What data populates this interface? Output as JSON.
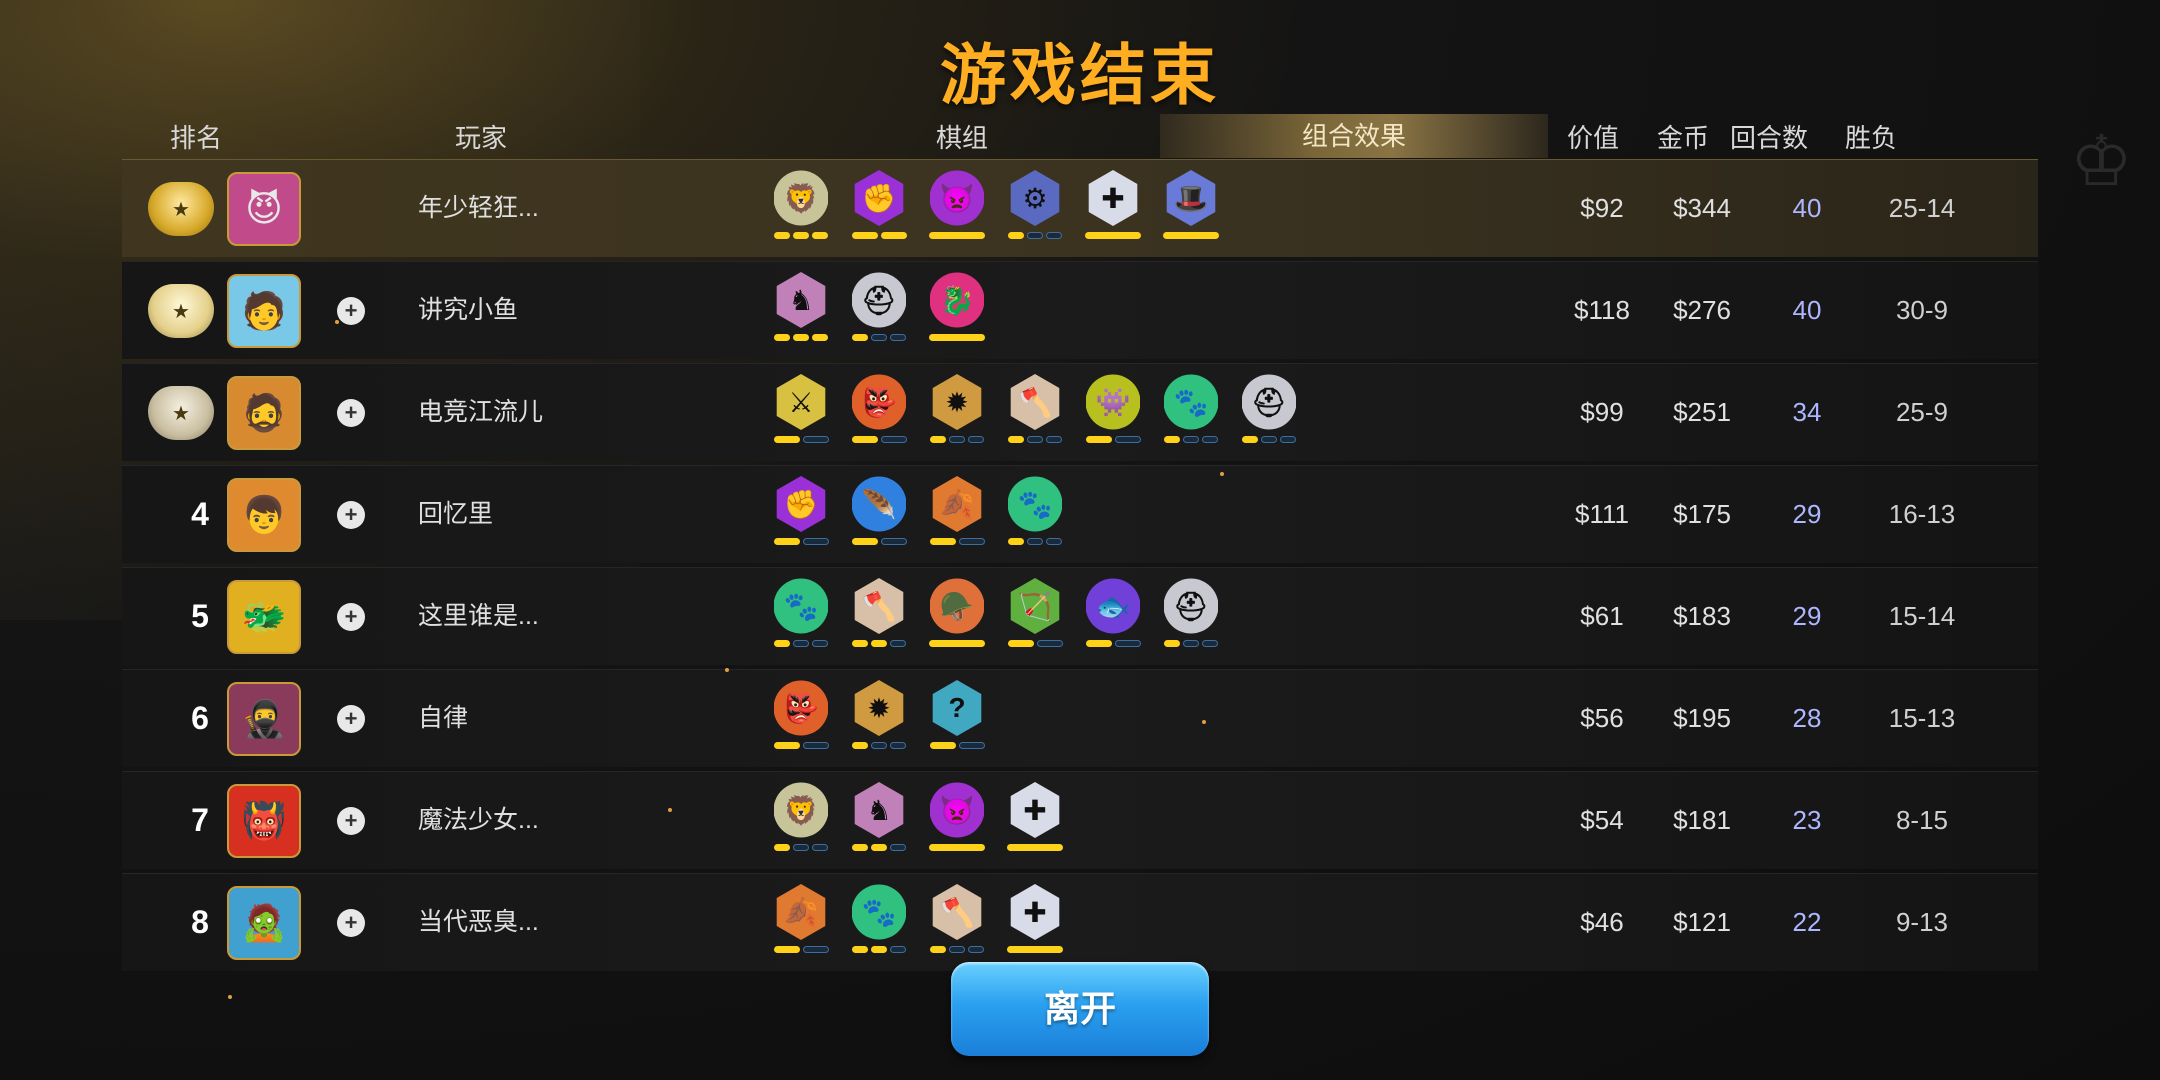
{
  "title": "游戏结束",
  "headers": {
    "rank": "排名",
    "player": "玩家",
    "pieces": "棋组",
    "combo": "组合效果",
    "value": "价值",
    "gold": "金币",
    "rounds": "回合数",
    "winloss": "胜负"
  },
  "rows": [
    {
      "rank": "1",
      "medal": "gold",
      "avatar_icon": "😈",
      "avatar_color": "#c04a8a",
      "player": "年少轻狂...",
      "value": "$92",
      "gold": "$344",
      "rounds": "40",
      "winloss": "25-14",
      "synergies": [
        {
          "icon": "lion-icon",
          "color": "#c8c49a",
          "pips": [
            1,
            1,
            1
          ]
        },
        {
          "icon": "fist-icon",
          "color": "#9a30d8",
          "pips": [
            1,
            1
          ]
        },
        {
          "icon": "demon-icon",
          "color": "#a030d0",
          "pips": [
            1
          ]
        },
        {
          "icon": "mech-icon",
          "color": "#5a6ac0",
          "pips": [
            1,
            0,
            0
          ]
        },
        {
          "icon": "knight-cross-icon",
          "color": "#d8dce8",
          "pips": [
            1
          ]
        },
        {
          "icon": "wizard-hat-icon",
          "color": "#6a7ad8",
          "pips": [
            1
          ]
        }
      ]
    },
    {
      "rank": "2",
      "medal": "silver",
      "avatar_icon": "🧑",
      "avatar_color": "#7ac8e8",
      "player": "讲究小鱼",
      "value": "$118",
      "gold": "$276",
      "rounds": "40",
      "winloss": "30-9",
      "synergies": [
        {
          "icon": "horse-icon",
          "color": "#c080b8",
          "pips": [
            1,
            1,
            1
          ]
        },
        {
          "icon": "helmet-icon",
          "color": "#c8c8d0",
          "pips": [
            1,
            0,
            0
          ]
        },
        {
          "icon": "dragon-icon",
          "color": "#e03080",
          "pips": [
            1
          ]
        }
      ]
    },
    {
      "rank": "3",
      "medal": "bronze",
      "avatar_icon": "🧔",
      "avatar_color": "#d88a30",
      "player": "电竞江流儿",
      "value": "$99",
      "gold": "$251",
      "rounds": "34",
      "winloss": "25-9",
      "synergies": [
        {
          "icon": "claw-icon",
          "color": "#d8c040",
          "pips": [
            1,
            0
          ]
        },
        {
          "icon": "orc-icon",
          "color": "#e0602a",
          "pips": [
            1,
            0
          ]
        },
        {
          "icon": "gear-icon",
          "color": "#d09a40",
          "pips": [
            1,
            0,
            0
          ]
        },
        {
          "icon": "axe-icon",
          "color": "#d8c0a8",
          "pips": [
            1,
            0,
            0
          ]
        },
        {
          "icon": "goblin-icon",
          "color": "#b8c020",
          "pips": [
            1,
            0
          ]
        },
        {
          "icon": "paw-icon",
          "color": "#30c080",
          "pips": [
            1,
            0,
            0
          ]
        },
        {
          "icon": "helmet-icon",
          "color": "#c8c8d0",
          "pips": [
            1,
            0,
            0
          ]
        }
      ]
    },
    {
      "rank": "4",
      "medal": "",
      "avatar_icon": "👦",
      "avatar_color": "#e08a30",
      "player": "回忆里",
      "value": "$111",
      "gold": "$175",
      "rounds": "29",
      "winloss": "16-13",
      "synergies": [
        {
          "icon": "fist-icon",
          "color": "#9a30d8",
          "pips": [
            1,
            0
          ]
        },
        {
          "icon": "feather-icon",
          "color": "#3080e0",
          "pips": [
            1,
            0
          ]
        },
        {
          "icon": "leaf-icon",
          "color": "#e07a30",
          "pips": [
            1,
            0
          ]
        },
        {
          "icon": "paw-icon",
          "color": "#30c080",
          "pips": [
            1,
            0,
            0
          ]
        }
      ]
    },
    {
      "rank": "5",
      "medal": "",
      "avatar_icon": "🐲",
      "avatar_color": "#e0b020",
      "player": "这里谁是...",
      "value": "$61",
      "gold": "$183",
      "rounds": "29",
      "winloss": "15-14",
      "synergies": [
        {
          "icon": "paw-icon",
          "color": "#30c080",
          "pips": [
            1,
            0,
            0
          ]
        },
        {
          "icon": "axe-icon",
          "color": "#d8c0a8",
          "pips": [
            1,
            1,
            0
          ]
        },
        {
          "icon": "viking-icon",
          "color": "#e0703a",
          "pips": [
            1
          ]
        },
        {
          "icon": "bow-icon",
          "color": "#60b040",
          "pips": [
            1,
            0
          ]
        },
        {
          "icon": "fishbone-icon",
          "color": "#7040d8",
          "pips": [
            1,
            0
          ]
        },
        {
          "icon": "helmet-icon",
          "color": "#c8c8d0",
          "pips": [
            1,
            0,
            0
          ]
        }
      ]
    },
    {
      "rank": "6",
      "medal": "",
      "avatar_icon": "🥷",
      "avatar_color": "#8a3a5a",
      "player": "自律",
      "value": "$56",
      "gold": "$195",
      "rounds": "28",
      "winloss": "15-13",
      "synergies": [
        {
          "icon": "orc-icon",
          "color": "#e0602a",
          "pips": [
            1,
            0
          ]
        },
        {
          "icon": "gear-icon",
          "color": "#d09a40",
          "pips": [
            1,
            0,
            0
          ]
        },
        {
          "icon": "mystery-icon",
          "color": "#40a8c0",
          "pips": [
            1,
            0
          ]
        }
      ]
    },
    {
      "rank": "7",
      "medal": "",
      "avatar_icon": "👹",
      "avatar_color": "#d83020",
      "player": "魔法少女...",
      "value": "$54",
      "gold": "$181",
      "rounds": "23",
      "winloss": "8-15",
      "synergies": [
        {
          "icon": "lion-icon",
          "color": "#c8c49a",
          "pips": [
            1,
            0,
            0
          ]
        },
        {
          "icon": "horse-icon",
          "color": "#c080b8",
          "pips": [
            1,
            1,
            0
          ]
        },
        {
          "icon": "demon-icon",
          "color": "#a030d0",
          "pips": [
            1
          ]
        },
        {
          "icon": "knight-cross-icon",
          "color": "#d8dce8",
          "pips": [
            1
          ]
        }
      ]
    },
    {
      "rank": "8",
      "medal": "",
      "avatar_icon": "🧟",
      "avatar_color": "#40a0d0",
      "player": "当代恶臭...",
      "value": "$46",
      "gold": "$121",
      "rounds": "22",
      "winloss": "9-13",
      "synergies": [
        {
          "icon": "leaf-icon",
          "color": "#e07a30",
          "pips": [
            1,
            0
          ]
        },
        {
          "icon": "paw-icon",
          "color": "#30c080",
          "pips": [
            1,
            1,
            0
          ]
        },
        {
          "icon": "axe-icon",
          "color": "#d8c0a8",
          "pips": [
            1,
            0,
            0
          ]
        },
        {
          "icon": "knight-cross-icon",
          "color": "#d8dce8",
          "pips": [
            1
          ]
        }
      ]
    }
  ],
  "leave_button": "离开",
  "colors": {
    "title": "#ffae22",
    "rounds": "#aeb6ff",
    "button": "#2aa0f0",
    "pip_on": "#ffd21a"
  }
}
